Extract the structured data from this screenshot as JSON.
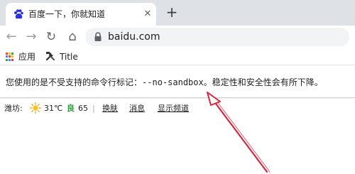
{
  "tab": {
    "title": "百度一下，你就知道",
    "close_glyph": "✕",
    "favicon": "baidu-paw-icon",
    "favicon_color": "#2932e1"
  },
  "new_tab_glyph": "+",
  "toolbar": {
    "back_glyph": "←",
    "forward_glyph": "→",
    "reload_glyph": "↻",
    "home_glyph": "⌂",
    "url": "baidu.com"
  },
  "bookmarks": [
    {
      "label": "应用",
      "icon": "apps-grid-icon"
    },
    {
      "label": "Title",
      "icon": "tools-icon"
    }
  ],
  "infobar": {
    "text_before": "您使用的是不受支持的命令行标记：",
    "flag": "--no-sandbox",
    "text_after": "。稳定性和安全性会有所下降。"
  },
  "baidu_bar": {
    "city": "潍坊:",
    "temperature": "31℃",
    "aqi_badge": "良",
    "aqi_value": "65",
    "separator": "|",
    "links": [
      "换肤",
      "消息",
      "显示频道"
    ]
  },
  "colors": {
    "accent": "#1a73e8",
    "annotation_arrow": "#d7263d",
    "aqi_good": "#22a33a"
  }
}
